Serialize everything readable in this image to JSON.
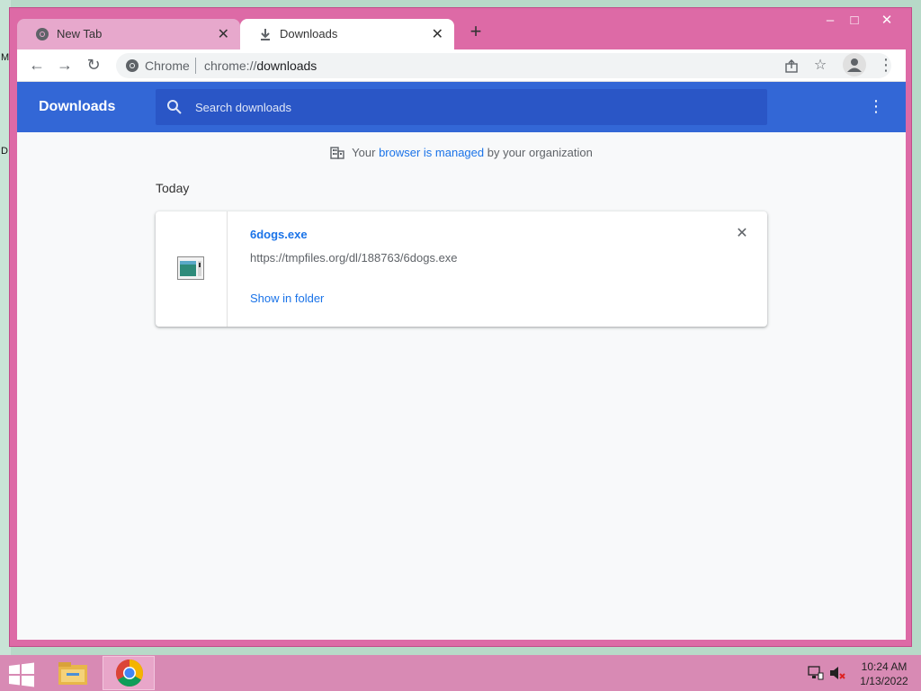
{
  "desktop": {
    "letters": [
      "M",
      "D"
    ]
  },
  "window": {
    "controls": {
      "minimize": "–",
      "maximize": "□",
      "close": "✕"
    },
    "tabs": [
      {
        "label": "New Tab",
        "icon": "chrome-icon",
        "active": false
      },
      {
        "label": "Downloads",
        "icon": "download-icon",
        "active": true
      }
    ],
    "new_tab_label": "+"
  },
  "toolbar": {
    "back": "←",
    "forward": "→",
    "reload": "↻",
    "site_label": "Chrome",
    "url_scheme": "chrome://",
    "url_host": "downloads",
    "menu": "⋮"
  },
  "downloads_page": {
    "title": "Downloads",
    "search_placeholder": "Search downloads",
    "header_menu": "⋮",
    "managed_prefix": "Your ",
    "managed_link": "browser is managed",
    "managed_suffix": " by your organization",
    "date_group": "Today",
    "items": [
      {
        "file_name": "6dogs.exe",
        "url": "https://tmpfiles.org/dl/188763/6dogs.exe",
        "action": "Show in folder",
        "remove": "✕"
      }
    ]
  },
  "taskbar": {
    "clock_time": "10:24 AM",
    "clock_date": "1/13/2022"
  },
  "colors": {
    "window_frame": "#dd6aa6",
    "header_blue": "#3367d6",
    "link_blue": "#1a73e8",
    "taskbar": "#d88ab4"
  }
}
